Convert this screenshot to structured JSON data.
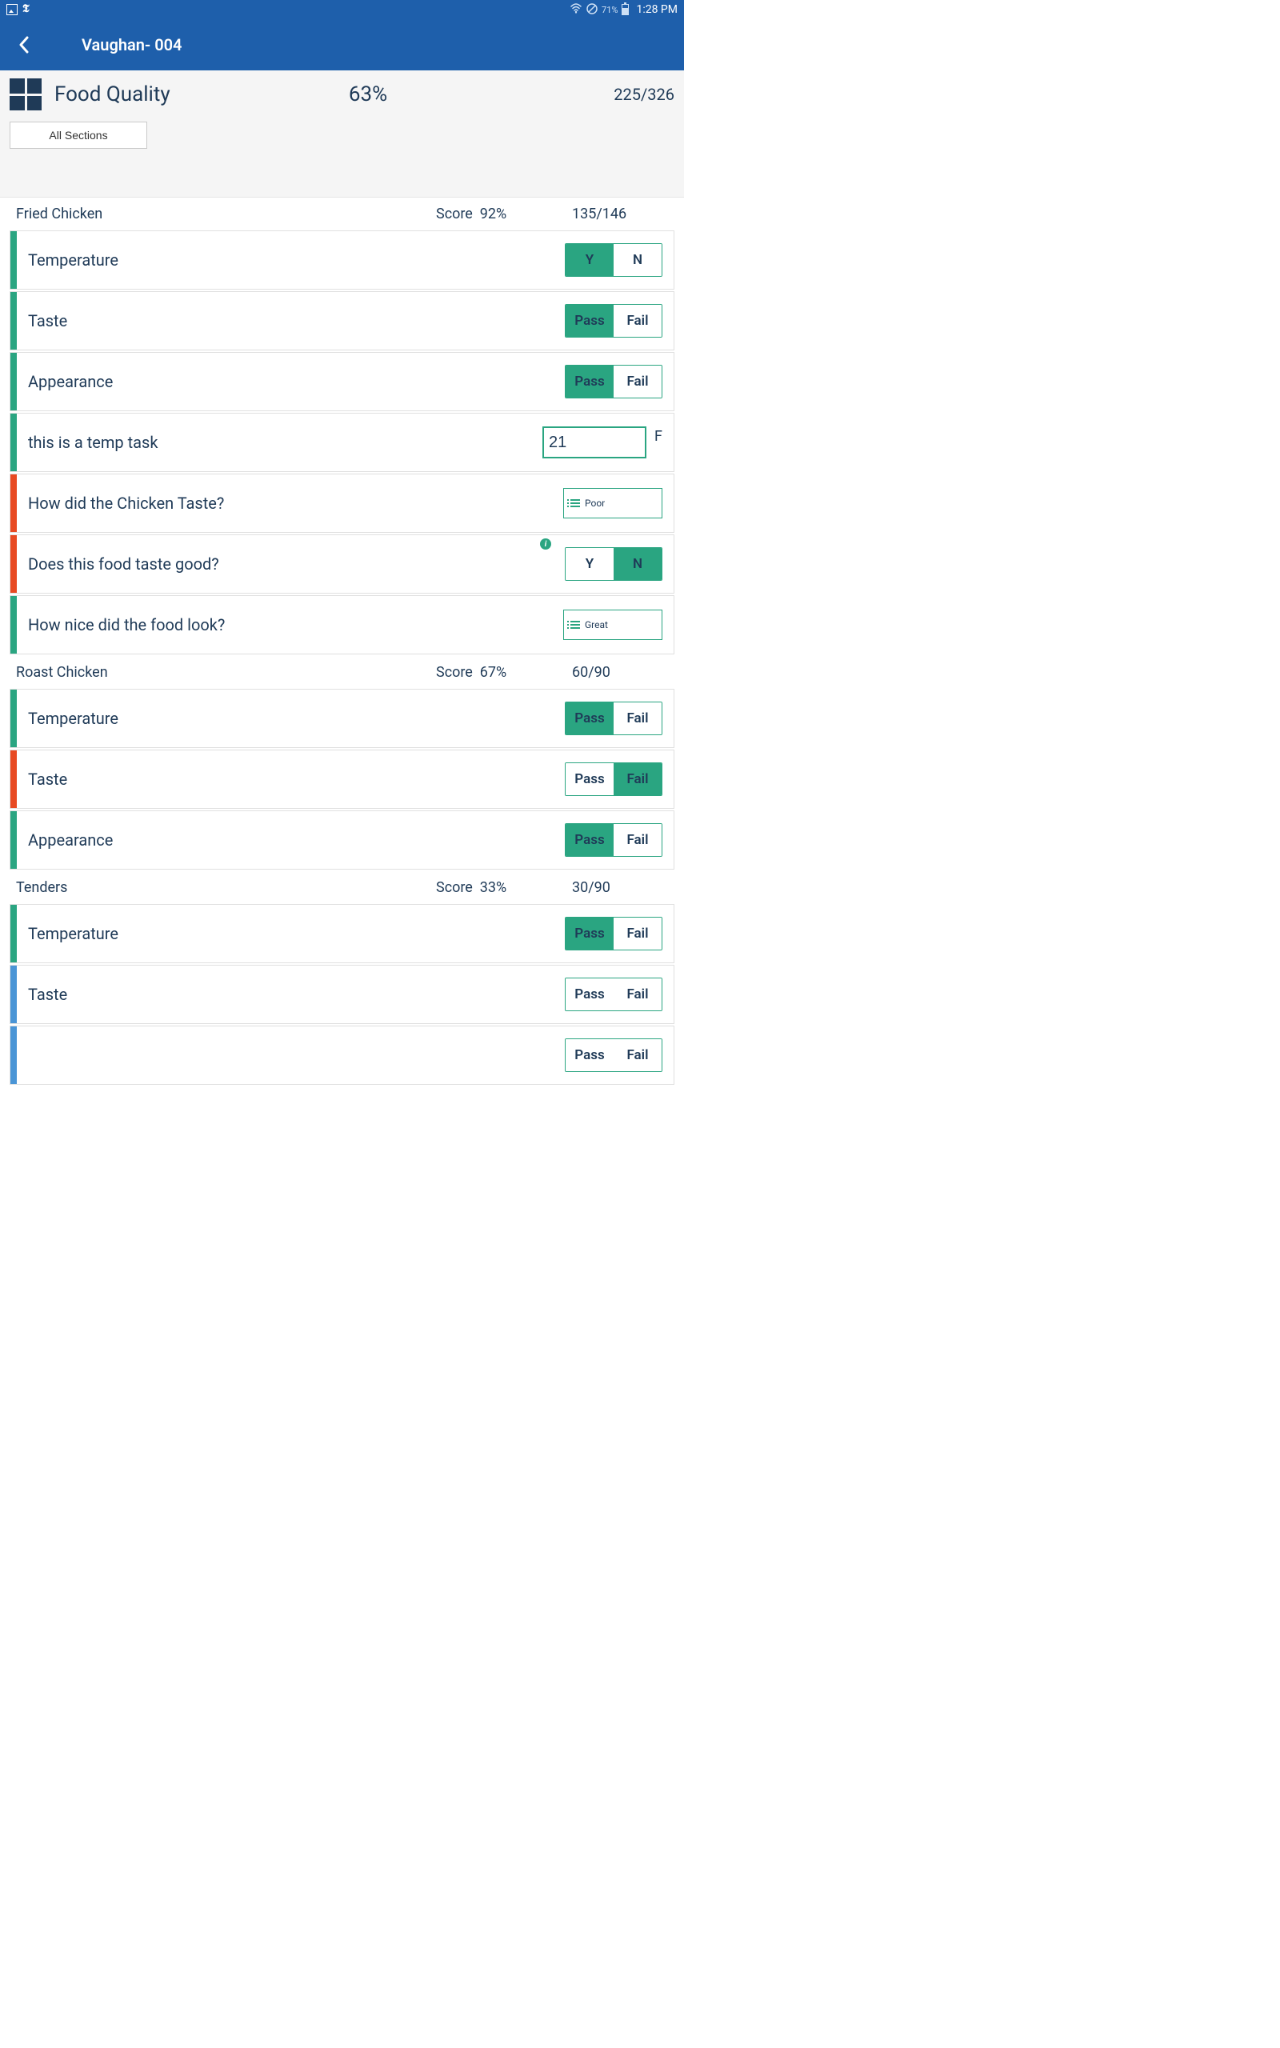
{
  "status": {
    "battery": "71%",
    "time": "1:28 PM"
  },
  "appbar": {
    "title": "Vaughan- 004"
  },
  "summary": {
    "title": "Food Quality",
    "percent": "63%",
    "count": "225/326",
    "all_sections": "All Sections"
  },
  "sections": [
    {
      "name": "Fried Chicken",
      "score_label": "Score",
      "score": "92%",
      "count": "135/146",
      "tasks": [
        {
          "label": "Temperature",
          "bar": "green",
          "type": "yn",
          "left": "Y",
          "right": "N",
          "active": "left"
        },
        {
          "label": "Taste",
          "bar": "green",
          "type": "pf",
          "left": "Pass",
          "right": "Fail",
          "active": "left"
        },
        {
          "label": "Appearance",
          "bar": "green",
          "type": "pf",
          "left": "Pass",
          "right": "Fail",
          "active": "left"
        },
        {
          "label": "this is a temp task",
          "bar": "green",
          "type": "num",
          "value": "21",
          "unit": "F"
        },
        {
          "label": "How did the Chicken Taste?",
          "bar": "red",
          "type": "select",
          "value": "Poor"
        },
        {
          "label": "Does this food taste good?",
          "bar": "red",
          "type": "yn",
          "left": "Y",
          "right": "N",
          "active": "right",
          "info": true
        },
        {
          "label": "How nice did the food look?",
          "bar": "green",
          "type": "select",
          "value": "Great"
        }
      ]
    },
    {
      "name": "Roast Chicken",
      "score_label": "Score",
      "score": "67%",
      "count": "60/90",
      "tasks": [
        {
          "label": "Temperature",
          "bar": "green",
          "type": "pf",
          "left": "Pass",
          "right": "Fail",
          "active": "left"
        },
        {
          "label": "Taste",
          "bar": "red",
          "type": "pf",
          "left": "Pass",
          "right": "Fail",
          "active": "right"
        },
        {
          "label": "Appearance",
          "bar": "green",
          "type": "pf",
          "left": "Pass",
          "right": "Fail",
          "active": "left"
        }
      ]
    },
    {
      "name": "Tenders",
      "score_label": "Score",
      "score": "33%",
      "count": "30/90",
      "tasks": [
        {
          "label": "Temperature",
          "bar": "green",
          "type": "pf",
          "left": "Pass",
          "right": "Fail",
          "active": "left"
        },
        {
          "label": "Taste",
          "bar": "blue",
          "type": "pf",
          "left": "Pass",
          "right": "Fail",
          "active": "none"
        },
        {
          "label": "",
          "bar": "blue",
          "type": "pf",
          "left": "Pass",
          "right": "Fail",
          "active": "none"
        }
      ]
    }
  ]
}
